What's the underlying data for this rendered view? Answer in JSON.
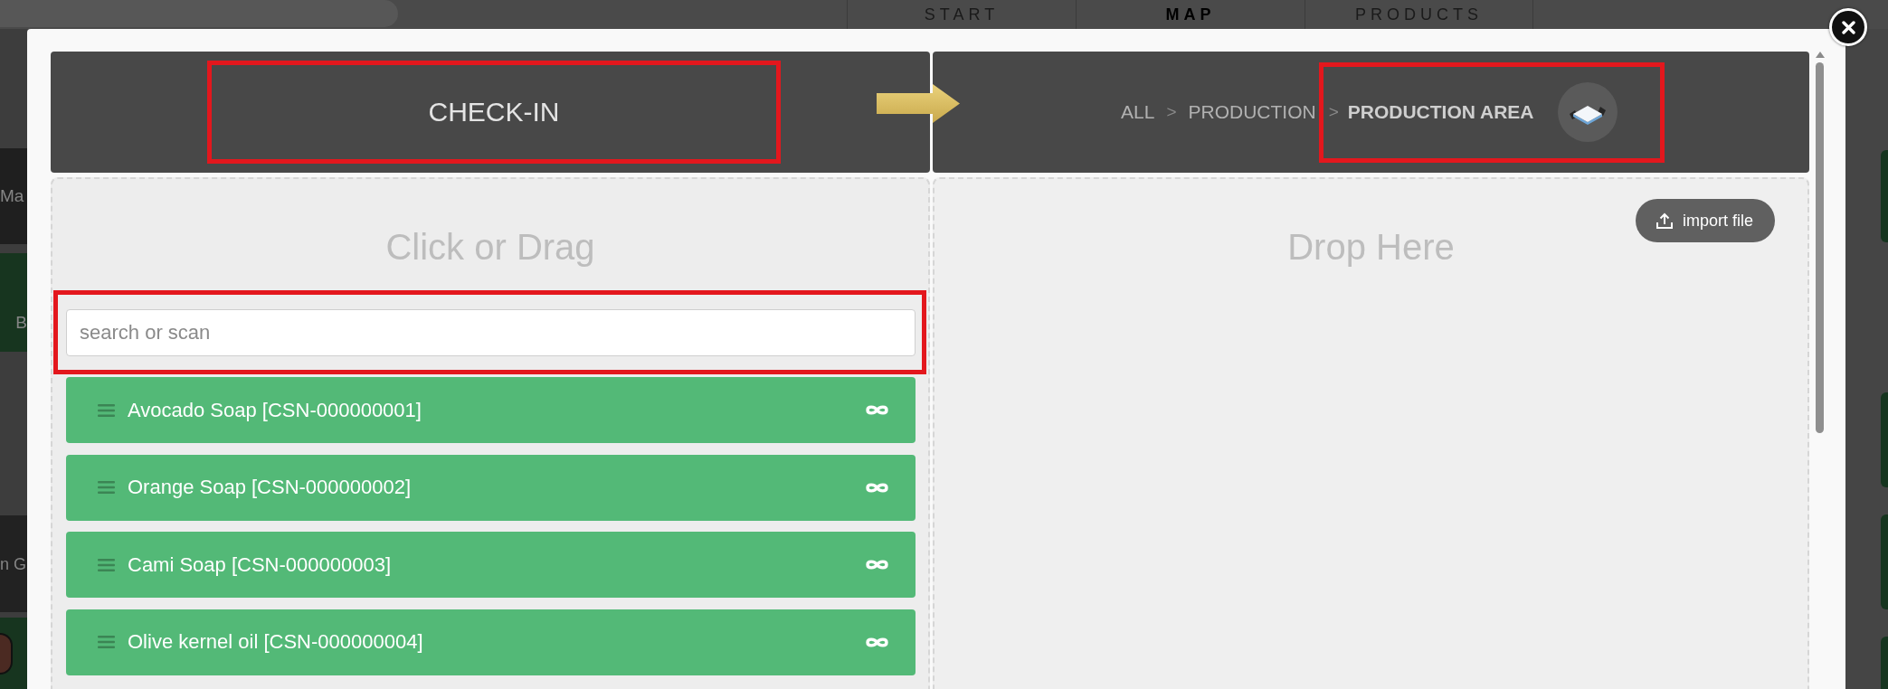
{
  "background": {
    "nav_tabs": [
      {
        "label": "START",
        "selected": false
      },
      {
        "label": "MAP",
        "selected": true
      },
      {
        "label": "PRODUCTS",
        "selected": false
      }
    ],
    "left_cards": [
      {
        "text": "Ma",
        "color": "#1f1f1f"
      },
      {
        "text": "B",
        "color": "#17351f"
      },
      {
        "text": "n G",
        "color": "#222222"
      },
      {
        "color": "#17351f",
        "avatar": true
      }
    ]
  },
  "modal": {
    "source": {
      "title": "CHECK-IN",
      "highlighted": true,
      "heading": "Click or Drag",
      "search": {
        "placeholder": "search or scan",
        "highlighted": true
      },
      "items": [
        {
          "label": "Avocado Soap [CSN-000000001]"
        },
        {
          "label": "Orange Soap [CSN-000000002]"
        },
        {
          "label": "Cami Soap [CSN-000000003]"
        },
        {
          "label": "Olive kernel oil [CSN-000000004]"
        }
      ]
    },
    "target": {
      "breadcrumb": [
        {
          "label": "ALL",
          "current": false,
          "highlighted": false
        },
        {
          "separator": ">",
          "label": "PRODUCTION",
          "current": false,
          "highlighted": false
        },
        {
          "separator": ">",
          "label": "PRODUCTION AREA",
          "current": true,
          "highlighted": true
        }
      ],
      "heading": "Drop Here",
      "import_button": {
        "label": "import file"
      }
    }
  }
}
